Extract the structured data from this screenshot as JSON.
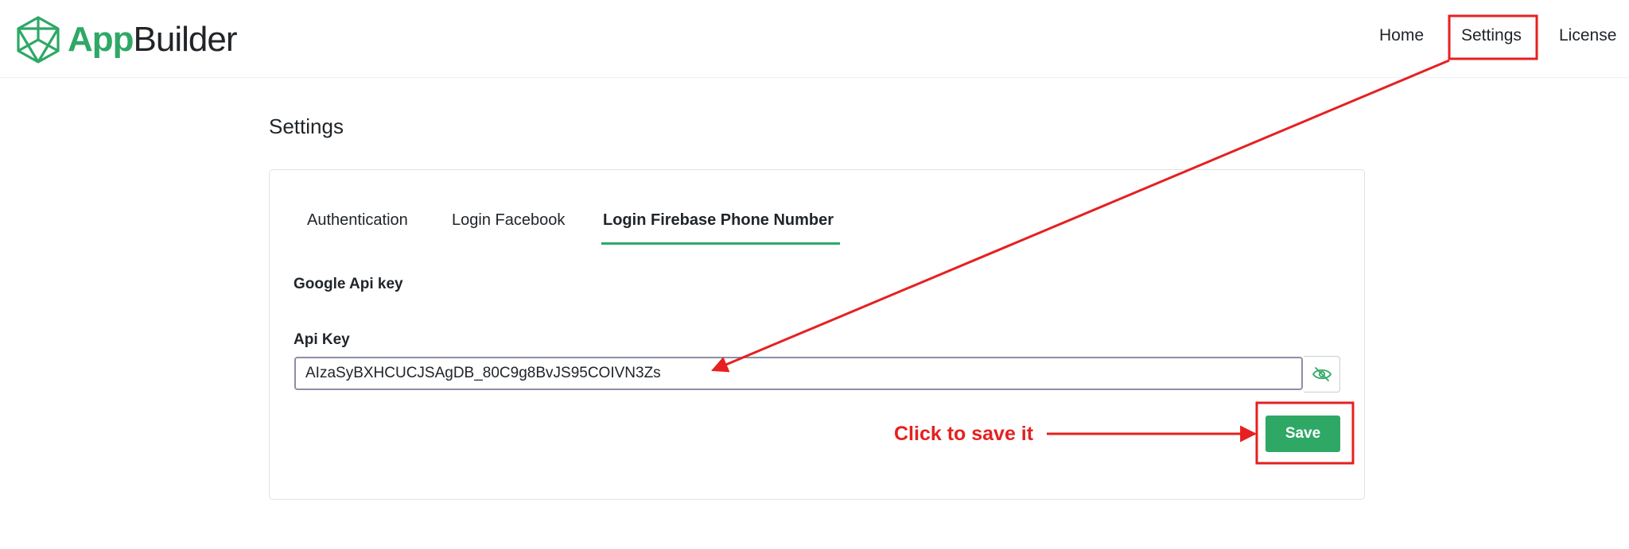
{
  "brand": {
    "part1": "App",
    "part2": "Builder"
  },
  "nav": {
    "home": "Home",
    "settings": "Settings",
    "license": "License"
  },
  "page": {
    "title": "Settings"
  },
  "tabs": [
    {
      "label": "Authentication",
      "active": false
    },
    {
      "label": "Login Facebook",
      "active": false
    },
    {
      "label": "Login Firebase Phone Number",
      "active": true
    }
  ],
  "form": {
    "section_title": "Google Api key",
    "api_key_label": "Api Key",
    "api_key_value": "AIzaSyBXHCUCJSAgDB_80C9g8BvJS95COIVN3Zs",
    "save_label": "Save"
  },
  "annotation": {
    "text": "Click to save it"
  },
  "colors": {
    "accent": "#2fa866",
    "annotation": "#e62020"
  },
  "icons": {
    "logo": "hexagon-cube-logo-icon",
    "toggle": "eye-slash-icon"
  }
}
